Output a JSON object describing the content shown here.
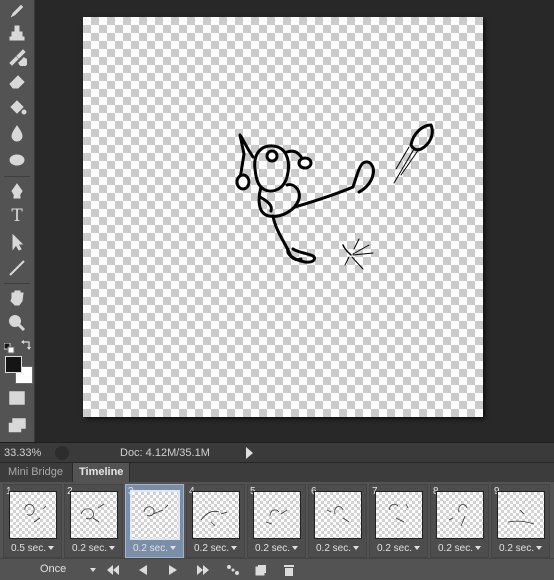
{
  "tools": [
    {
      "icon": "pencil-icon"
    },
    {
      "icon": "clone-stamp-icon"
    },
    {
      "icon": "history-brush-icon"
    },
    {
      "icon": "eraser-icon"
    },
    {
      "icon": "paint-bucket-icon"
    },
    {
      "icon": "blur-icon"
    },
    {
      "icon": "sponge-icon"
    },
    {
      "icon": "pen-icon"
    },
    {
      "icon": "type-icon",
      "glyph": "T"
    },
    {
      "icon": "path-selection-icon"
    },
    {
      "icon": "line-icon"
    },
    {
      "icon": "hand-icon"
    },
    {
      "icon": "zoom-icon"
    },
    {
      "icon": "quick-mask-icon"
    },
    {
      "icon": "screen-mode-icon"
    }
  ],
  "colors": {
    "foreground": "#151515",
    "background": "#ffffff",
    "selected_frame": "#7b8ea8"
  },
  "status": {
    "zoom": "33.33%",
    "doc_info": "Doc: 4.12M/35.1M"
  },
  "panel_tabs": {
    "mini_bridge": "Mini Bridge",
    "timeline": "Timeline",
    "active": "Timeline"
  },
  "timeline": {
    "selected_frame": 3,
    "frames": [
      {
        "number": "1",
        "delay": "0.5 sec."
      },
      {
        "number": "2",
        "delay": "0.2 sec."
      },
      {
        "number": "3",
        "delay": "0.2 sec."
      },
      {
        "number": "4",
        "delay": "0.2 sec."
      },
      {
        "number": "5",
        "delay": "0.2 sec."
      },
      {
        "number": "6",
        "delay": "0.2 sec."
      },
      {
        "number": "7",
        "delay": "0.2 sec."
      },
      {
        "number": "8",
        "delay": "0.2 sec."
      },
      {
        "number": "9",
        "delay": "0.2 sec."
      }
    ],
    "loop": "Once",
    "controls": [
      {
        "icon": "first-frame-icon"
      },
      {
        "icon": "previous-frame-icon"
      },
      {
        "icon": "play-icon"
      },
      {
        "icon": "next-frame-icon"
      },
      {
        "icon": "tween-icon"
      },
      {
        "icon": "duplicate-frame-icon"
      },
      {
        "icon": "delete-frame-icon"
      }
    ]
  }
}
